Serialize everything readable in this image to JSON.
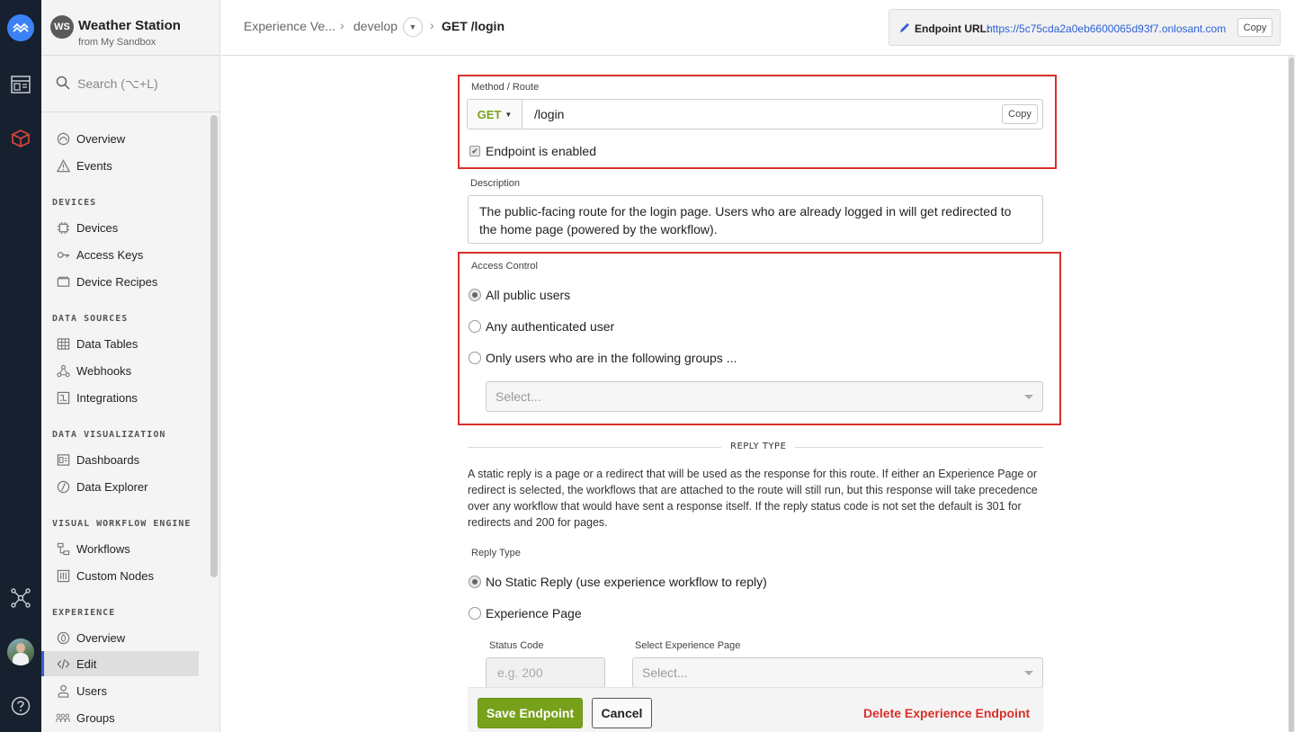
{
  "app": {
    "badge": "WS",
    "name": "Weather Station",
    "subtitle": "from My Sandbox"
  },
  "search": {
    "placeholder": "Search (⌥+L)"
  },
  "sidebar": {
    "top_items": [
      {
        "label": "Overview",
        "icon": "overview-icon"
      },
      {
        "label": "Events",
        "icon": "warning-icon"
      }
    ],
    "sections": [
      {
        "title": "DEVICES",
        "items": [
          {
            "label": "Devices",
            "icon": "chip-icon"
          },
          {
            "label": "Access Keys",
            "icon": "key-icon"
          },
          {
            "label": "Device Recipes",
            "icon": "recipe-icon"
          }
        ]
      },
      {
        "title": "DATA SOURCES",
        "items": [
          {
            "label": "Data Tables",
            "icon": "table-icon"
          },
          {
            "label": "Webhooks",
            "icon": "webhook-icon"
          },
          {
            "label": "Integrations",
            "icon": "integration-icon"
          }
        ]
      },
      {
        "title": "DATA VISUALIZATION",
        "items": [
          {
            "label": "Dashboards",
            "icon": "dashboard-icon"
          },
          {
            "label": "Data Explorer",
            "icon": "explorer-icon"
          }
        ]
      },
      {
        "title": "VISUAL WORKFLOW ENGINE",
        "items": [
          {
            "label": "Workflows",
            "icon": "workflow-icon"
          },
          {
            "label": "Custom Nodes",
            "icon": "custom-nodes-icon"
          }
        ]
      },
      {
        "title": "EXPERIENCE",
        "items": [
          {
            "label": "Overview",
            "icon": "experience-overview-icon"
          },
          {
            "label": "Edit",
            "icon": "code-icon",
            "active": true
          },
          {
            "label": "Users",
            "icon": "user-icon"
          },
          {
            "label": "Groups",
            "icon": "groups-icon"
          }
        ]
      }
    ]
  },
  "breadcrumb": {
    "items": [
      "Experience Ve...",
      "develop",
      "GET /login"
    ],
    "separator": "›"
  },
  "endpoint_url": {
    "label": "Endpoint URL:",
    "url": "https://5c75cda2a0eb6600065d93f7.onlosant.com",
    "copy_label": "Copy"
  },
  "form": {
    "method_route_label": "Method / Route",
    "method": "GET",
    "route": "/login",
    "route_copy_label": "Copy",
    "enabled_label": "Endpoint is enabled",
    "enabled": true,
    "description_label": "Description",
    "description": "The public-facing route for the login page. Users who are already logged in will get redirected to the home page (powered by the workflow).",
    "access_control_label": "Access Control",
    "access_options": [
      "All public users",
      "Any authenticated user",
      "Only users who are in the following groups ..."
    ],
    "access_selected": 0,
    "groups_placeholder": "Select...",
    "reply_type_heading": "REPLY TYPE",
    "reply_type_paragraph": "A static reply is a page or a redirect that will be used as the response for this route. If either an Experience Page or redirect is selected, the workflows that are attached to the route will still run, but this response will take precedence over any workflow that would have sent a response itself. If the reply status code is not set the default is 301 for redirects and 200 for pages.",
    "reply_type_label": "Reply Type",
    "reply_options": [
      "No Static Reply (use experience workflow to reply)",
      "Experience Page"
    ],
    "reply_selected": 0,
    "status_code_label": "Status Code",
    "status_code_placeholder": "e.g. 200",
    "experience_page_label": "Select Experience Page",
    "experience_page_placeholder": "Select..."
  },
  "actions": {
    "save": "Save Endpoint",
    "cancel": "Cancel",
    "delete": "Delete Experience Endpoint"
  },
  "colors": {
    "accent_red": "#d9302a",
    "save_green": "#77a11b",
    "link_blue": "#2b5fd9",
    "rail_dark": "#17202e"
  }
}
